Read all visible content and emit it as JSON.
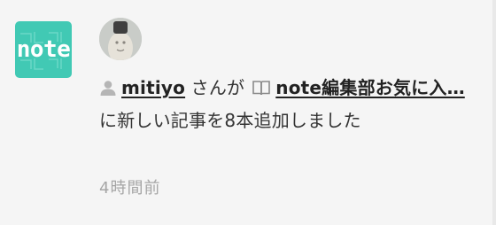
{
  "notification": {
    "logo_text": "note",
    "user_name": "mitiyo",
    "text_after_user": "さんが",
    "magazine_name": "note編集部お気に入…",
    "text_after_magazine": "に新しい記事を8本追加しました",
    "timestamp": "4時間前"
  },
  "colors": {
    "brand": "#41c9b4",
    "background": "#f5f5f5",
    "text": "#222222",
    "muted": "#a6a6a6"
  },
  "icons": {
    "logo": "note-logo",
    "user": "user-icon",
    "magazine": "book-icon"
  }
}
